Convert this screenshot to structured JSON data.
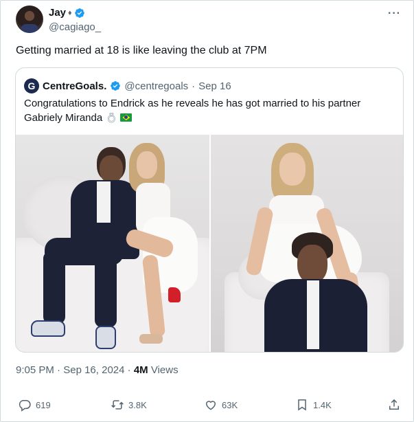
{
  "author": {
    "name": "Jay",
    "handle": "@cagiago_"
  },
  "tweet": {
    "text": "Getting married at 18 is like leaving the club at 7PM",
    "time": "9:05 PM",
    "separator": "·",
    "date": "Sep 16, 2024",
    "views_count": "4M",
    "views_label": "Views"
  },
  "quoted": {
    "logo_letter": "G",
    "name": "CentreGoals.",
    "handle": "@centregoals",
    "separator": "·",
    "date": "Sep 16",
    "text": "Congratulations to Endrick as he reveals he has got married to his partner Gabriely Miranda"
  },
  "actions": {
    "replies": "619",
    "reposts": "3.8K",
    "likes": "63K",
    "bookmarks": "1.4K"
  },
  "icons": [
    "verified-badge-icon",
    "more-icon",
    "reply-icon",
    "repost-icon",
    "like-icon",
    "bookmark-icon",
    "share-icon",
    "ring-icon",
    "brazil-flag-icon"
  ],
  "colors": {
    "verified": "#1d9bf0",
    "secondary_text": "#536471",
    "border": "#cfd9de"
  }
}
